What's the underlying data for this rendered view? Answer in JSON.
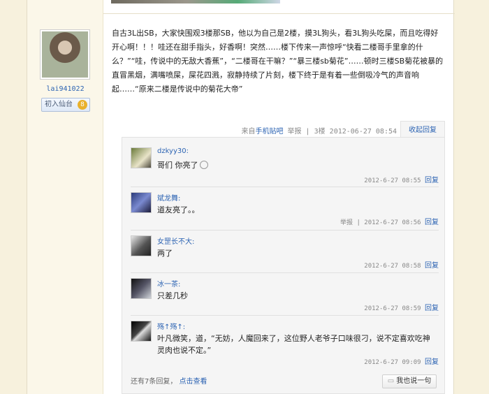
{
  "user": {
    "username": "lai941022",
    "level_label": "初入仙台",
    "level": "8"
  },
  "post": {
    "text": "自古3L出SB，大家快围观3楼那SB，他以为自己是2楼，摸3L狗头，看3L狗头吃屎，而且吃得好开心啊！！！哇还在甜手指头，好香啊！突然……楼下传来一声惊呼“快看二楼哥手里拿的什么？”“哇，传说中的无敌大香蕉”，“二楼哥在干嘛？”“暴三楼sb菊花”……顿时三楼SB菊花被暴的直冒黑烟，满嘴喷屎，屎花四溅，寂静持续了片刻，楼下终于是有着一些倒吸冷气的声音响起……“原来二楼是传说中的菊花大帝”",
    "meta_prefix": "来自",
    "meta_source": "手机贴吧",
    "meta_report": "举报",
    "meta_sep": "|",
    "meta_floor": "3楼",
    "meta_time": "2012-06-27 08:54",
    "fold_label": "收起回复"
  },
  "replies": [
    {
      "name": "dzkyy30:",
      "text": "哥们 你亮了",
      "report": "",
      "time": "2012-6-27 08:55",
      "reply_label": "回复"
    },
    {
      "name": "斌龙舞:",
      "text": "道友亮了。。",
      "report": "举报 |",
      "time": "2012-6-27 08:56",
      "reply_label": "回复"
    },
    {
      "name": "女罡长不大:",
      "text": "两了",
      "report": "",
      "time": "2012-6-27 08:58",
      "reply_label": "回复"
    },
    {
      "name": "冰一茶:",
      "text": "只差几秒",
      "report": "",
      "time": "2012-6-27 08:59",
      "reply_label": "回复"
    },
    {
      "name": "殇↑殇↑:",
      "text": "叶凡微笑，道，“无妨，人魔回来了，这位野人老爷子口味很刁，说不定喜欢吃神灵肉也说不定。”",
      "report": "",
      "time": "2012-6-27 09:09",
      "reply_label": "回复"
    }
  ],
  "footer": {
    "more_text": "还有7条回复，",
    "more_link": "点击查看",
    "say_label": "我也说一句"
  }
}
